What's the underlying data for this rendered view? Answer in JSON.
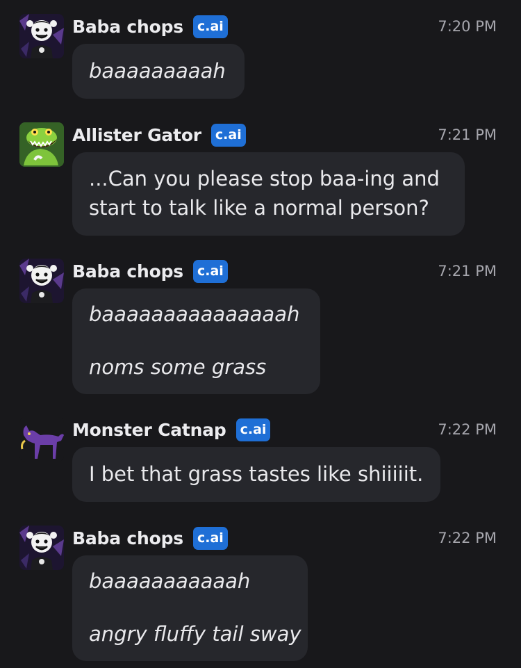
{
  "colors": {
    "background": "#18181b",
    "bubble": "#26272c",
    "badge": "#1f6fd6",
    "timestamp": "#a6a6ad"
  },
  "messages": [
    {
      "author": "Baba chops",
      "badge": "c.ai",
      "time": "7:20 PM",
      "avatar_icon": "sheep-avatar",
      "lines": [
        "baaaaaaaaah"
      ],
      "italic": true
    },
    {
      "author": "Allister Gator",
      "badge": "c.ai",
      "time": "7:21 PM",
      "avatar_icon": "gator-avatar",
      "lines": [
        "...Can you please stop baa-ing and",
        "start to talk like a normal person?"
      ],
      "italic": false
    },
    {
      "author": "Baba chops",
      "badge": "c.ai",
      "time": "7:21 PM",
      "avatar_icon": "sheep-avatar",
      "lines": [
        "baaaaaaaaaaaaaaah",
        "noms some grass"
      ],
      "italic": true
    },
    {
      "author": "Monster Catnap",
      "badge": "c.ai",
      "time": "7:22 PM",
      "avatar_icon": "cat-avatar",
      "lines": [
        "I bet that grass tastes like shiiiiit."
      ],
      "italic": false
    },
    {
      "author": "Baba chops",
      "badge": "c.ai",
      "time": "7:22 PM",
      "avatar_icon": "sheep-avatar",
      "lines": [
        "baaaaaaaaaaah",
        "angry fluffy tail sway"
      ],
      "italic": true
    }
  ]
}
